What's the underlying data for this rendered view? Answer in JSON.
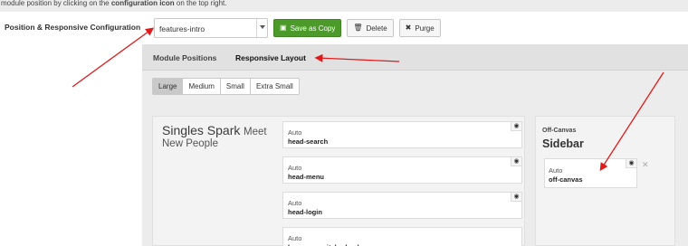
{
  "help_text": {
    "before": "module position by clicking on the ",
    "bold": "configuration icon",
    "after": " on the top right."
  },
  "section_label": "Position & Responsive Configuration",
  "position_select": {
    "value": "features-intro"
  },
  "buttons": {
    "save_as_copy": {
      "label": "Save as Copy",
      "icon": "floppy-disk-icon"
    },
    "delete": {
      "label": "Delete",
      "icon": "trash-icon"
    },
    "purge": {
      "label": "Purge",
      "icon": "x-icon"
    }
  },
  "tabs": [
    {
      "label": "Module Positions",
      "active": false
    },
    {
      "label": "Responsive Layout",
      "active": true
    }
  ],
  "breakpoints": [
    {
      "label": "Large",
      "selected": true
    },
    {
      "label": "Medium",
      "selected": false
    },
    {
      "label": "Small",
      "selected": false
    },
    {
      "label": "Extra Small",
      "selected": false
    }
  ],
  "logo": {
    "main": "Singles Spark",
    "suffix": "Meet",
    "tagline": "New People"
  },
  "modules": [
    {
      "top": "Auto",
      "name": "head-search",
      "icon": "eye-icon"
    },
    {
      "top": "Auto",
      "name": "head-menu",
      "icon": "eye-icon"
    },
    {
      "top": "Auto",
      "name": "head-login",
      "icon": "eye-icon"
    },
    {
      "top": "Auto",
      "name": "languageswitcherload",
      "icon": "eye-icon"
    }
  ],
  "offcanvas": {
    "label": "Off-Canvas",
    "title": "Sidebar",
    "module": {
      "top": "Auto",
      "name": "off-canvas",
      "icon": "eye-icon"
    },
    "close_icon": "close-icon"
  },
  "colors": {
    "accent_green": "#4c9a2a",
    "annotation_red": "#e01a1a"
  }
}
